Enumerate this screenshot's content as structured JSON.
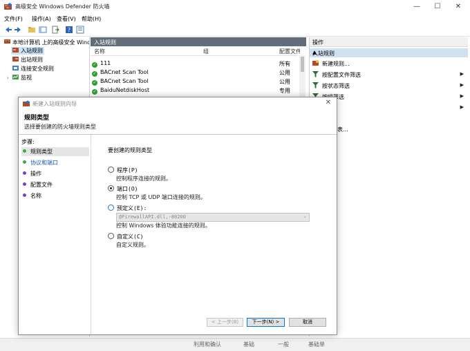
{
  "window": {
    "title": "高级安全 Windows Defender 防火墙",
    "minimize_glyph": "—",
    "maximize_glyph": "☐",
    "close_glyph": "✕"
  },
  "menu": [
    "文件(F)",
    "操作(A)",
    "查看(V)",
    "帮助(H)"
  ],
  "tree": {
    "root": "本地计算机 上的高级安全 Windows Defender 防火墙",
    "items": [
      "入站规则",
      "出站规则",
      "连接安全规则",
      "监视"
    ]
  },
  "middle": {
    "header": "入站规则",
    "columns": {
      "name": "名称",
      "group": "组",
      "profile": "配置文件"
    },
    "rows": [
      {
        "name": "111",
        "profile": "所有"
      },
      {
        "name": "BACnet Scan Tool",
        "profile": "公用"
      },
      {
        "name": "BACnet Scan Tool",
        "profile": "公用"
      },
      {
        "name": "BaiduNetdiskHost",
        "profile": "专用"
      }
    ]
  },
  "actions": {
    "header": "操作",
    "section": "入站规则",
    "items": [
      "新建规则...",
      "按配置文件筛选",
      "按状态筛选",
      "按组筛选"
    ],
    "partial_item": "列表..."
  },
  "dialog": {
    "title": "新建入站规则向导",
    "heading": "规则类型",
    "subheading": "选择要创建的防火墙规则类型",
    "steps_title": "步骤:",
    "steps": [
      "规则类型",
      "协议和端口",
      "操作",
      "配置文件",
      "名称"
    ],
    "question": "要创建的规则类型",
    "options": [
      {
        "label": "程序(P)",
        "desc": "控制程序连接的规则。"
      },
      {
        "label": "端口(O)",
        "desc": "控制 TCP 或 UDP 端口连接的规则。"
      },
      {
        "label": "预定义(E):",
        "desc": "控制 Windows 体验功能连接的规则。"
      },
      {
        "label": "自定义(C)",
        "desc": "自定义规则。"
      }
    ],
    "predefined_value": "@FirewallAPI.dll,-80200",
    "buttons": {
      "back": "< 上一步(B)",
      "next": "下一步(N) >",
      "cancel": "取消"
    }
  },
  "status": {
    "fragments": [
      "利用和确认",
      "基础",
      "一般",
      "基础单"
    ]
  },
  "colors": {
    "mid_header": "#626d7a",
    "action_selected": "#cfe0f1",
    "step_active_dot": "#3fae3f",
    "step_inactive_dot": "#7b3fbf",
    "link_blue": "#1b57a6"
  }
}
